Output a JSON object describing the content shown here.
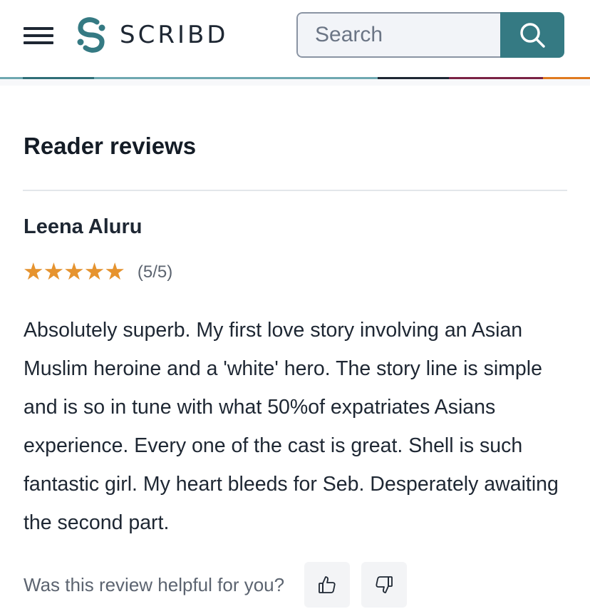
{
  "header": {
    "logo_text": "SCRIBD",
    "search_placeholder": "Search",
    "brand_color": "#357a83"
  },
  "reviews": {
    "title": "Reader reviews",
    "items": [
      {
        "author": "Leena Aluru",
        "rating": 5,
        "rating_max": 5,
        "rating_text": "(5/5)",
        "body": "Absolutely superb. My first love story involving an Asian Muslim heroine and a 'white' hero. The story line is simple and is so in tune with what 50%of expatriates Asians experience. Every one of the cast is great. Shell is such fantastic girl. My heart bleeds for Seb. Desperately awaiting the second part.",
        "helpful_prompt": "Was this review helpful for you?"
      }
    ]
  },
  "icons": {
    "menu": "hamburger-menu-icon",
    "search": "search-icon",
    "thumbs_up": "thumbs-up-icon",
    "thumbs_down": "thumbs-down-icon",
    "star": "star-icon"
  },
  "colors": {
    "star": "#e6932e",
    "accent": "#6ea8b0"
  }
}
